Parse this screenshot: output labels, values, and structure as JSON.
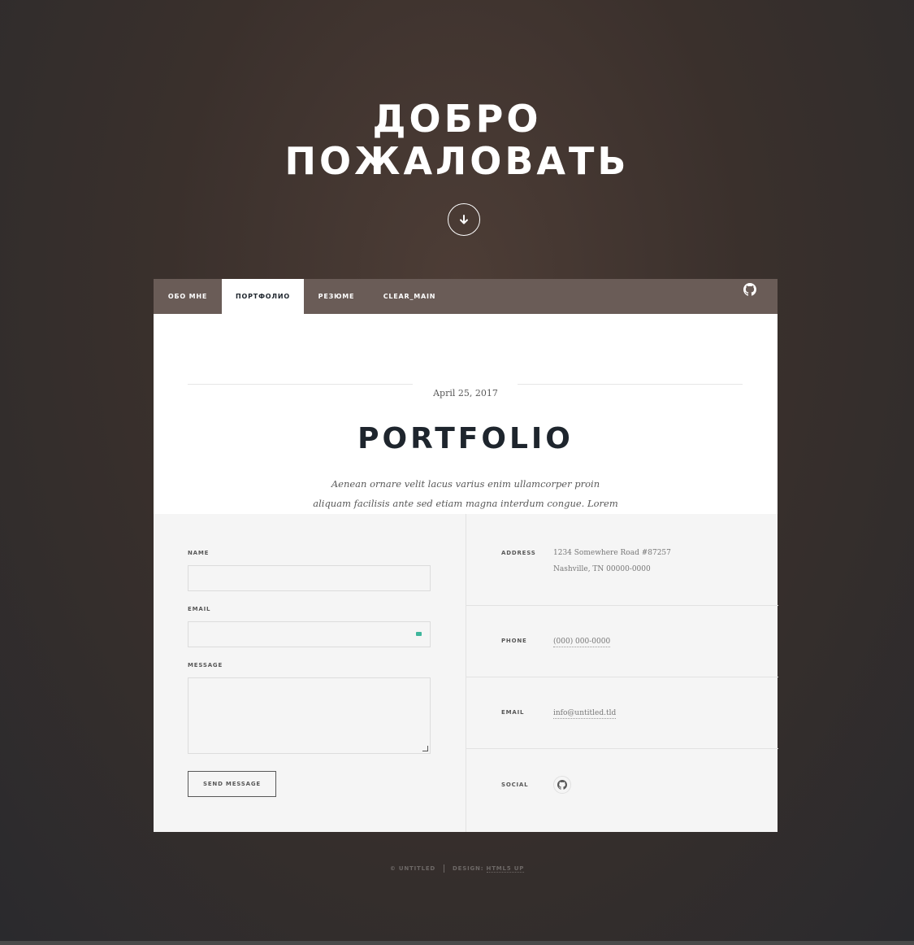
{
  "intro": {
    "title_line1": "ДОБРО",
    "title_line2": "ПОЖАЛОВАТЬ",
    "scroll_icon": "arrow-down-icon"
  },
  "nav": {
    "items": [
      {
        "label": "ОБО МНЕ",
        "active": false
      },
      {
        "label": "ПОРТФОЛИО",
        "active": true
      },
      {
        "label": "РЕЗЮМЕ",
        "active": false
      },
      {
        "label": "CLEAR_MAIN",
        "active": false
      }
    ],
    "github_icon": "github-icon"
  },
  "post": {
    "date": "April 25, 2017",
    "title": "PORTFOLIO",
    "text": "Aenean ornare velit lacus varius enim ullamcorper proin aliquam facilisis ante sed etiam magna interdum congue. Lorem ipsum dolor amet nullam sed etiam veroeros."
  },
  "form": {
    "name_label": "NAME",
    "email_label": "EMAIL",
    "message_label": "MESSAGE",
    "send_label": "SEND MESSAGE"
  },
  "contact": {
    "address_label": "ADDRESS",
    "address_line1": "1234 Somewhere Road #87257",
    "address_line2": "Nashville, TN 00000-0000",
    "phone_label": "PHONE",
    "phone_value": "(000) 000-0000",
    "email_label": "EMAIL",
    "email_value": "info@untitled.tld",
    "social_label": "SOCIAL",
    "social_icon": "github-icon"
  },
  "footer": {
    "copyright": "© UNTITLED",
    "design_prefix": "DESIGN:",
    "design_link": "HTML5 UP"
  },
  "colors": {
    "nav_bg": "#6a5c57",
    "title": "#1e252d",
    "panel_gray": "#f5f5f5",
    "autofill_accent": "#3fb69c"
  }
}
